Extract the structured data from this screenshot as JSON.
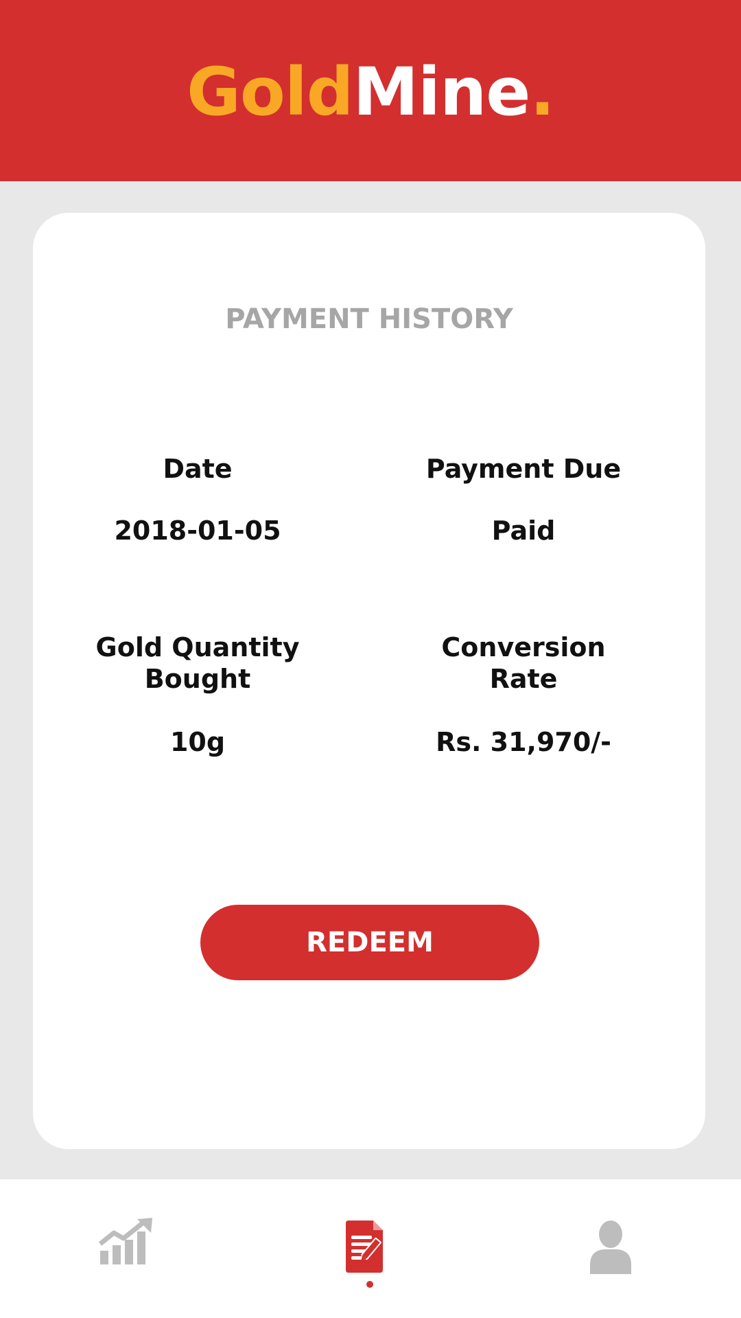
{
  "header": {
    "logo_gold": "Gold",
    "logo_mine": "Mine",
    "logo_dot": "."
  },
  "card": {
    "title": "PAYMENT HISTORY",
    "fields": {
      "date_label": "Date",
      "date_value": "2018-01-05",
      "payment_due_label": "Payment Due",
      "payment_due_value": "Paid",
      "gold_qty_label_line1": "Gold Quantity",
      "gold_qty_label_line2": "Bought",
      "gold_qty_value": "10g",
      "conversion_label_line1": "Conversion",
      "conversion_label_line2": "Rate",
      "conversion_value": "Rs. 31,970/-"
    },
    "redeem_label": "REDEEM"
  },
  "nav": {
    "items": [
      {
        "icon": "chart-growth-icon",
        "active": false
      },
      {
        "icon": "document-edit-icon",
        "active": true
      },
      {
        "icon": "user-icon",
        "active": false
      }
    ]
  },
  "colors": {
    "brand_red": "#d32f2f",
    "brand_gold": "#f9a825",
    "inactive_icon": "#bdbdbd",
    "background": "#e8e8e8"
  }
}
